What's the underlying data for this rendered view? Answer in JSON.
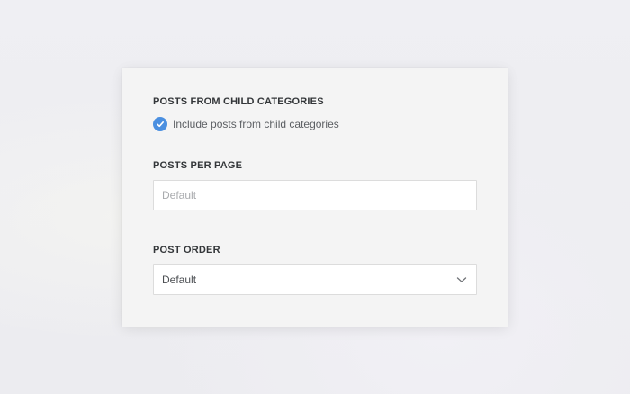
{
  "sections": {
    "child_categories": {
      "title": "POSTS FROM CHILD CATEGORIES",
      "checkbox_label": "Include posts from child categories",
      "checked": true
    },
    "posts_per_page": {
      "title": "POSTS PER PAGE",
      "placeholder": "Default",
      "value": ""
    },
    "post_order": {
      "title": "POST ORDER",
      "selected": "Default"
    }
  },
  "icons": {
    "checkbox": "check-icon",
    "dropdown": "chevron-down-icon"
  },
  "colors": {
    "accent": "#4a8fe0",
    "panel": "#f4f4f4",
    "heading": "#333639"
  }
}
